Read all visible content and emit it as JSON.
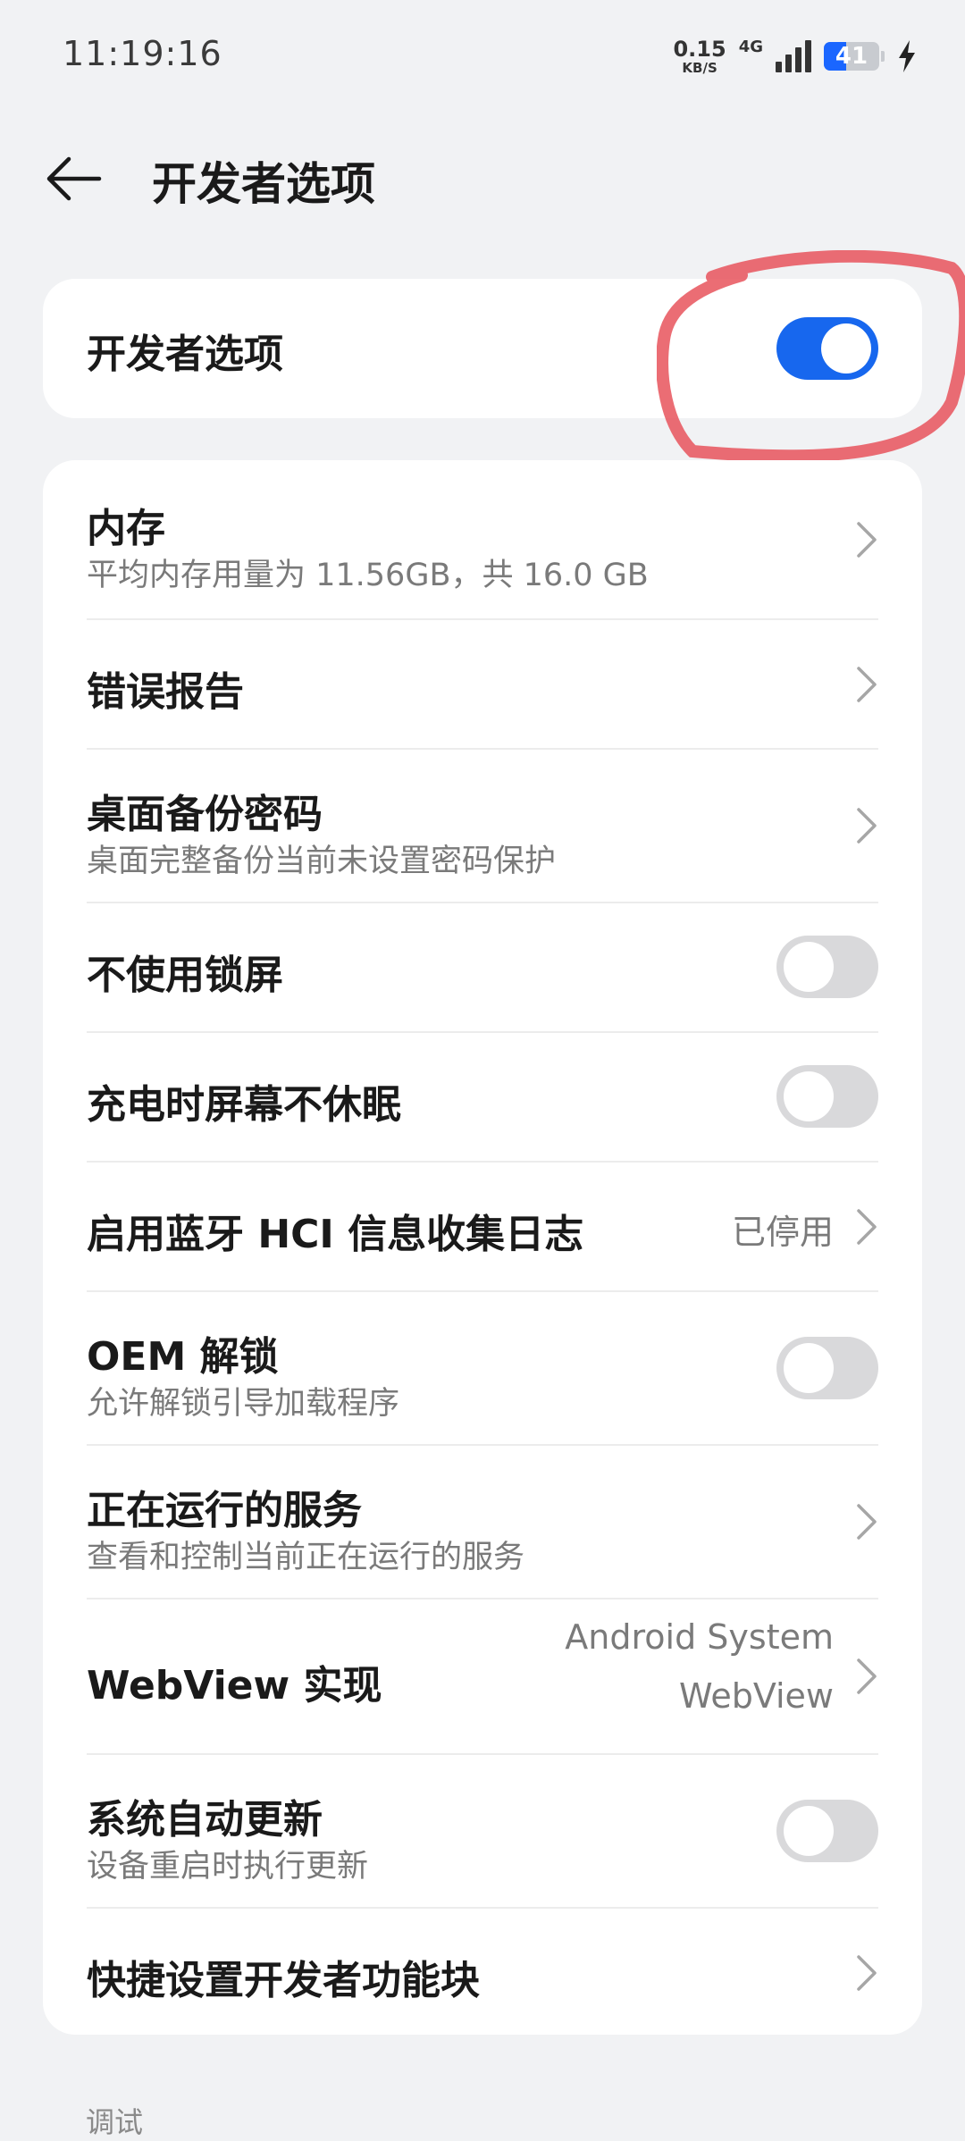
{
  "status_bar": {
    "time": "11:19:16",
    "net_speed_value": "0.15",
    "net_speed_unit": "KB/S",
    "network_type": "4G",
    "battery_level": "41",
    "battery_fraction": 0.41
  },
  "header": {
    "title": "开发者选项",
    "back_icon": "arrow-left-icon"
  },
  "master": {
    "label": "开发者选项",
    "enabled": true
  },
  "items": [
    {
      "title": "内存",
      "subtitle": "平均内存用量为 11.56GB，共 16.0 GB",
      "control": "chevron"
    },
    {
      "title": "错误报告",
      "control": "chevron"
    },
    {
      "title": "桌面备份密码",
      "subtitle": "桌面完整备份当前未设置密码保护",
      "control": "chevron"
    },
    {
      "title": "不使用锁屏",
      "control": "toggle",
      "on": false
    },
    {
      "title": "充电时屏幕不休眠",
      "control": "toggle",
      "on": false
    },
    {
      "title": "启用蓝牙 HCI 信息收集日志",
      "value": "已停用",
      "control": "chevron"
    },
    {
      "title": "OEM 解锁",
      "subtitle": "允许解锁引导加载程序",
      "control": "toggle",
      "on": false
    },
    {
      "title": "正在运行的服务",
      "subtitle": "查看和控制当前正在运行的服务",
      "control": "chevron"
    },
    {
      "title": "WebView 实现",
      "value_line1": "Android System",
      "value_line2": "WebView",
      "control": "chevron"
    },
    {
      "title": "系统自动更新",
      "subtitle": "设备重启时执行更新",
      "control": "toggle",
      "on": false
    },
    {
      "title": "快捷设置开发者功能块",
      "control": "chevron"
    }
  ],
  "section_label": "调试",
  "colors": {
    "accent": "#1767ee",
    "background": "#f1f2f4",
    "annotation": "#e8545c"
  }
}
